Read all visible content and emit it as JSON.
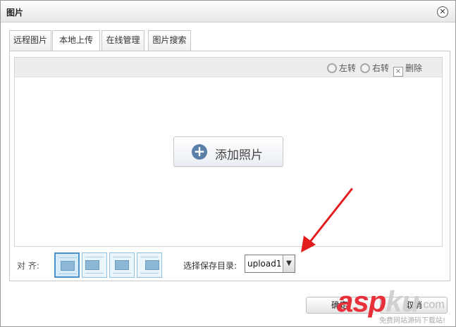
{
  "dialog": {
    "title": "图片",
    "close_glyph": "✕"
  },
  "tabs": [
    {
      "label": "远程图片",
      "active": false
    },
    {
      "label": "本地上传",
      "active": true
    },
    {
      "label": "在线管理",
      "active": false
    },
    {
      "label": "图片搜索",
      "active": false
    }
  ],
  "toolbar": {
    "rotate_left": "左转",
    "rotate_right": "右转",
    "delete": "删除"
  },
  "upload": {
    "add_photo_label": "添加照片",
    "plus_glyph": "+"
  },
  "options": {
    "align_label": "对 齐:",
    "align_choices": [
      "none",
      "left",
      "center",
      "right"
    ],
    "selected_align": "none",
    "dir_label": "选择保存目录:",
    "dir_value": "upload1",
    "dir_arrow": "▼"
  },
  "footer": {
    "ok_label": "确定",
    "cancel_label": "取消"
  },
  "watermark": {
    "asp": "asp",
    "ku": "ku",
    "dotcom": ".com",
    "subtitle": "免费网站源码下载站!"
  },
  "colors": {
    "accent": "#5a7fa8",
    "arrow": "#e21b1b",
    "selected_border": "#4a90c9"
  }
}
